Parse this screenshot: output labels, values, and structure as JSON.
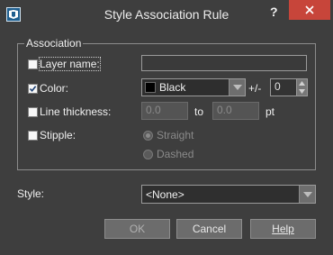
{
  "window": {
    "title": "Style Association Rule",
    "help_glyph": "?",
    "close_icon": "close-icon"
  },
  "association": {
    "legend": "Association",
    "layer_name": {
      "label": "Layer name:",
      "checked": false,
      "value": ""
    },
    "color": {
      "label": "Color:",
      "checked": true,
      "selected": "Black",
      "swatch": "#000000",
      "tolerance_label": "+/-",
      "tolerance_value": "0"
    },
    "line_thickness": {
      "label": "Line thickness:",
      "checked": false,
      "from_value": "0.0",
      "to_label": "to",
      "to_value": "0.0",
      "unit": "pt"
    },
    "stipple": {
      "label": "Stipple:",
      "checked": false,
      "options": [
        "Straight",
        "Dashed"
      ]
    }
  },
  "style": {
    "label": "Style:",
    "selected": "<None>"
  },
  "buttons": {
    "ok": "OK",
    "cancel": "Cancel",
    "help": "Help"
  }
}
